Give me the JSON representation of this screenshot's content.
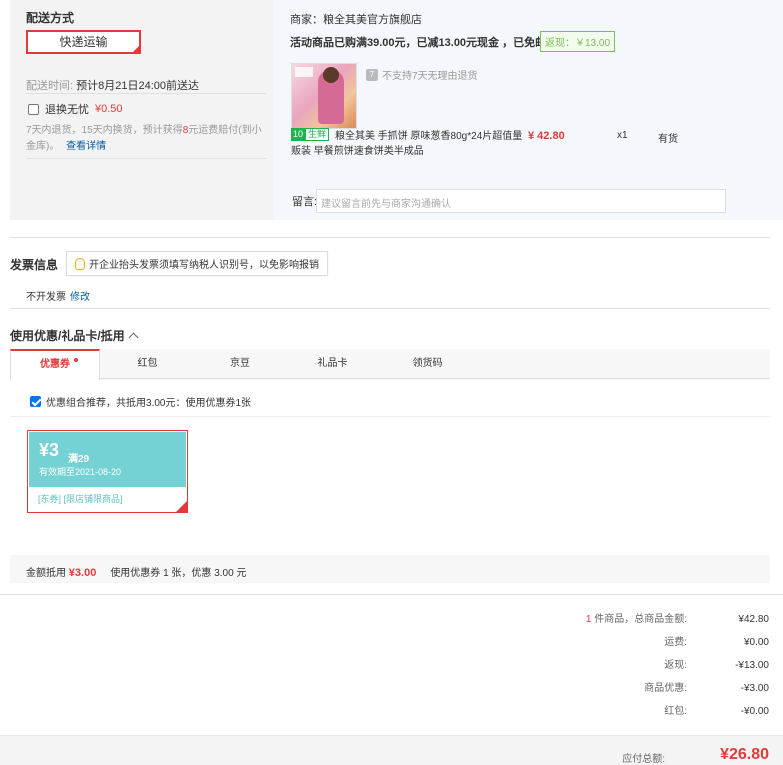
{
  "shipping": {
    "title": "配送方式",
    "method_button": "快递运输",
    "time_label": "配送时间:",
    "time_value": "预计8月21日24:00前送达",
    "insurance_label": "退换无忧",
    "insurance_price": "¥0.50",
    "insurance_note_a": "7天内退货，15天内换货，预计获得",
    "insurance_note_b": "8",
    "insurance_note_c": "元运费赔付(到小金库)。",
    "insurance_link": "查看详情"
  },
  "merchant": {
    "name": "商家：粮全其美官方旗舰店",
    "promo": "活动商品已购满39.00元，已减13.00元现金 ，已免邮",
    "fanxian": "返现：￥13.00",
    "no_return": "不支持7天无理由退货",
    "no_return_icon": "7",
    "fresh_badge_a": "10",
    "fresh_badge_b": "生鲜",
    "product_title": "粮全其美 手抓饼 原味葱香80g*24片超值量贩装 早餐煎饼速食饼类半成品",
    "product_price": "¥ 42.80",
    "product_qty": "x1",
    "product_stock": "有货",
    "memo_label": "留言:",
    "memo_placeholder": "建议留言前先与商家沟通确认"
  },
  "invoice": {
    "title": "发票信息",
    "tip": "开企业抬头发票须填写纳税人识别号，以免影响报销",
    "status": "不开发票",
    "modify": "修改"
  },
  "discount": {
    "title": "使用优惠/礼品卡/抵用",
    "tabs": [
      "优惠券",
      "红包",
      "京豆",
      "礼品卡",
      "领货码"
    ],
    "combo": "优惠组合推荐，共抵用3.00元：使用优惠券1张",
    "coupon": {
      "amount": "¥3",
      "min": "满29",
      "expiry": "有效期至2021-08-20",
      "tag": "[东券] [限店铺限商品]"
    },
    "summary_label": "金额抵用",
    "summary_amount": "¥3.00",
    "summary_detail": "使用优惠券 1 张，优惠 3.00 元"
  },
  "totals": {
    "count": "1",
    "count_suffix": " 件商品，总商品金额:",
    "rows": [
      {
        "label": "运费:",
        "value": "¥0.00"
      },
      {
        "label": "返现:",
        "value": "-¥13.00"
      },
      {
        "label": "商品优惠:",
        "value": "-¥3.00"
      },
      {
        "label": "红包:",
        "value": "-¥0.00"
      }
    ],
    "goods_total": "¥42.80",
    "grand_label": "应付总额:",
    "grand_value": "¥26.80"
  }
}
